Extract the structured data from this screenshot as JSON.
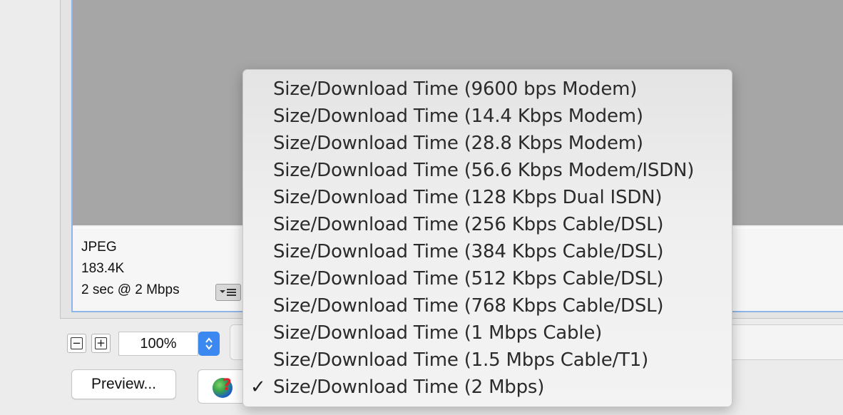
{
  "preview": {
    "format": "JPEG",
    "file_size": "183.4K",
    "download_time": "2 sec @ 2 Mbps"
  },
  "zoom": {
    "minus": "−",
    "plus": "+",
    "value": "100%"
  },
  "buttons": {
    "preview_label": "Preview..."
  },
  "menu": {
    "items": [
      {
        "label": "Size/Download Time (9600 bps Modem)",
        "checked": false
      },
      {
        "label": "Size/Download Time (14.4 Kbps Modem)",
        "checked": false
      },
      {
        "label": "Size/Download Time (28.8 Kbps Modem)",
        "checked": false
      },
      {
        "label": "Size/Download Time (56.6 Kbps Modem/ISDN)",
        "checked": false
      },
      {
        "label": "Size/Download Time (128 Kbps Dual ISDN)",
        "checked": false
      },
      {
        "label": "Size/Download Time (256 Kbps Cable/DSL)",
        "checked": false
      },
      {
        "label": "Size/Download Time (384 Kbps Cable/DSL)",
        "checked": false
      },
      {
        "label": "Size/Download Time (512 Kbps Cable/DSL)",
        "checked": false
      },
      {
        "label": "Size/Download Time (768 Kbps Cable/DSL)",
        "checked": false
      },
      {
        "label": "Size/Download Time (1 Mbps Cable)",
        "checked": false
      },
      {
        "label": "Size/Download Time (1.5 Mbps Cable/T1)",
        "checked": false
      },
      {
        "label": "Size/Download Time (2 Mbps)",
        "checked": true
      }
    ],
    "check_glyph": "✓"
  },
  "colors": {
    "accent": "#3b89f0",
    "canvas": "#a6a6a6",
    "selection_border": "#8fb4ea",
    "browser_icon_mark": "#d8262b"
  },
  "icons": {
    "menu_button": "optimize-menu-icon",
    "browser": "browser-globe-icon",
    "stepper": "up-down-chevron-icon"
  }
}
